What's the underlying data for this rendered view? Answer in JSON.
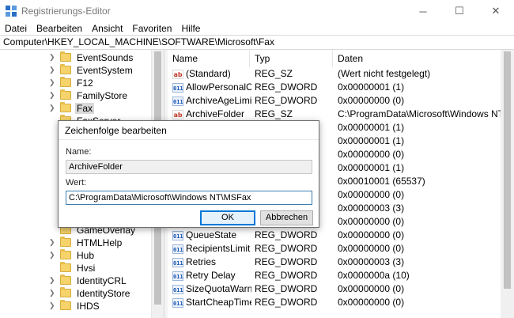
{
  "window": {
    "title": "Registrierungs-Editor",
    "controls": {
      "minimize": "─",
      "maximize": "☐",
      "close": "✕"
    }
  },
  "menu": [
    "Datei",
    "Bearbeiten",
    "Ansicht",
    "Favoriten",
    "Hilfe"
  ],
  "address": "Computer\\HKEY_LOCAL_MACHINE\\SOFTWARE\\Microsoft\\Fax",
  "tree": {
    "items": [
      "EventSounds",
      "EventSystem",
      "F12",
      "FamilyStore",
      "Fax",
      "FaxServer",
      "GameOverlay",
      "HTMLHelp",
      "Hub",
      "Hvsi",
      "IdentityCRL",
      "IdentityStore",
      "IHDS"
    ],
    "selected": "Fax"
  },
  "columns": {
    "name": "Name",
    "type": "Typ",
    "data": "Daten"
  },
  "values": [
    {
      "name": "(Standard)",
      "type": "REG_SZ",
      "data": "(Wert nicht festgelegt)",
      "icon": "string-value-icon"
    },
    {
      "name": "AllowPersonalC...",
      "type": "REG_DWORD",
      "data": "0x00000001 (1)",
      "icon": "dword-value-icon"
    },
    {
      "name": "ArchiveAgeLimit",
      "type": "REG_DWORD",
      "data": "0x00000000 (0)",
      "icon": "dword-value-icon"
    },
    {
      "name": "ArchiveFolder",
      "type": "REG_SZ",
      "data": "C:\\ProgramData\\Microsoft\\Windows NT\\MSFax",
      "icon": "string-value-icon"
    },
    {
      "name": "",
      "type": "",
      "data": "0x00000001 (1)",
      "icon": "dword-value-icon"
    },
    {
      "name": "",
      "type": "",
      "data": "0x00000001 (1)",
      "icon": "dword-value-icon"
    },
    {
      "name": "",
      "type": "",
      "data": "0x00000000 (0)",
      "icon": "dword-value-icon"
    },
    {
      "name": "",
      "type": "",
      "data": "0x00000001 (1)",
      "icon": "dword-value-icon"
    },
    {
      "name": "",
      "type": "",
      "data": "0x00010001 (65537)",
      "icon": "dword-value-icon"
    },
    {
      "name": "",
      "type": "",
      "data": "0x00000000 (0)",
      "icon": "dword-value-icon"
    },
    {
      "name": "",
      "type": "",
      "data": "0x00000003 (3)",
      "icon": "dword-value-icon"
    },
    {
      "name": "",
      "type": "",
      "data": "0x00000000 (0)",
      "icon": "dword-value-icon"
    },
    {
      "name": "QueueState",
      "type": "REG_DWORD",
      "data": "0x00000000 (0)",
      "icon": "dword-value-icon"
    },
    {
      "name": "RecipientsLimit",
      "type": "REG_DWORD",
      "data": "0x00000000 (0)",
      "icon": "dword-value-icon"
    },
    {
      "name": "Retries",
      "type": "REG_DWORD",
      "data": "0x00000003 (3)",
      "icon": "dword-value-icon"
    },
    {
      "name": "Retry Delay",
      "type": "REG_DWORD",
      "data": "0x0000000a (10)",
      "icon": "dword-value-icon"
    },
    {
      "name": "SizeQuotaWarn",
      "type": "REG_DWORD",
      "data": "0x00000000 (0)",
      "icon": "dword-value-icon"
    },
    {
      "name": "StartCheapTime",
      "type": "REG_DWORD",
      "data": "0x00000000 (0)",
      "icon": "dword-value-icon"
    }
  ],
  "dialog": {
    "title": "Zeichenfolge bearbeiten",
    "name_label": "Name:",
    "name_value": "ArchiveFolder",
    "value_label": "Wert:",
    "value_value": "C:\\ProgramData\\Microsoft\\Windows NT\\MSFax",
    "ok": "OK",
    "cancel": "Abbrechen"
  }
}
